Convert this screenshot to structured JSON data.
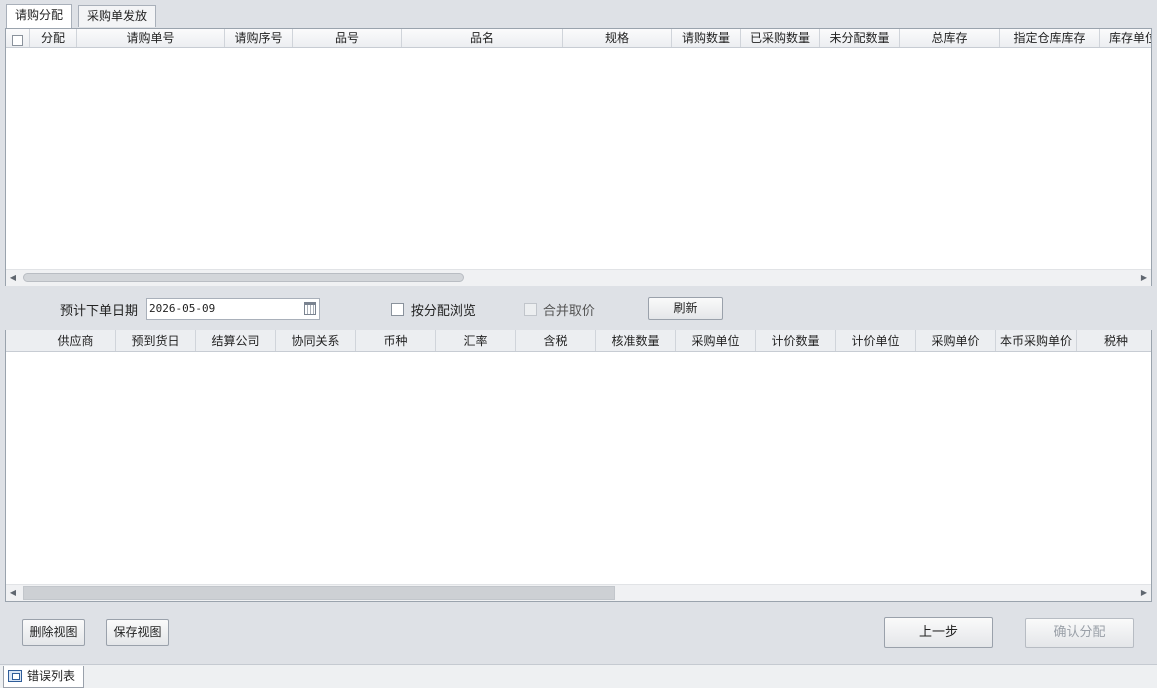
{
  "tabs": [
    {
      "label": "请购分配",
      "active": true
    },
    {
      "label": "采购单发放",
      "active": false
    }
  ],
  "top_grid": {
    "columns": [
      "分配",
      "请购单号",
      "请购序号",
      "品号",
      "品名",
      "规格",
      "请购数量",
      "已采购数量",
      "未分配数量",
      "总库存",
      "指定仓库库存",
      "库存单位"
    ]
  },
  "filters": {
    "date_label": "预计下单日期",
    "date_value": "2026-05-09",
    "by_allocation_label": "按分配浏览",
    "merge_price_label": "合并取价",
    "refresh_label": "刷新"
  },
  "bottom_grid": {
    "columns": [
      "供应商",
      "预到货日",
      "结算公司",
      "协同关系",
      "币种",
      "汇率",
      "含税",
      "核准数量",
      "采购单位",
      "计价数量",
      "计价单位",
      "采购单价",
      "本币采购单价",
      "税种"
    ]
  },
  "footer": {
    "delete_view": "删除视图",
    "save_view": "保存视图",
    "prev_step": "上一步",
    "confirm_alloc": "确认分配"
  },
  "statusbar": {
    "error_list": "错误列表"
  },
  "icons": {
    "scroll_left": "◀",
    "scroll_right": "▶"
  }
}
